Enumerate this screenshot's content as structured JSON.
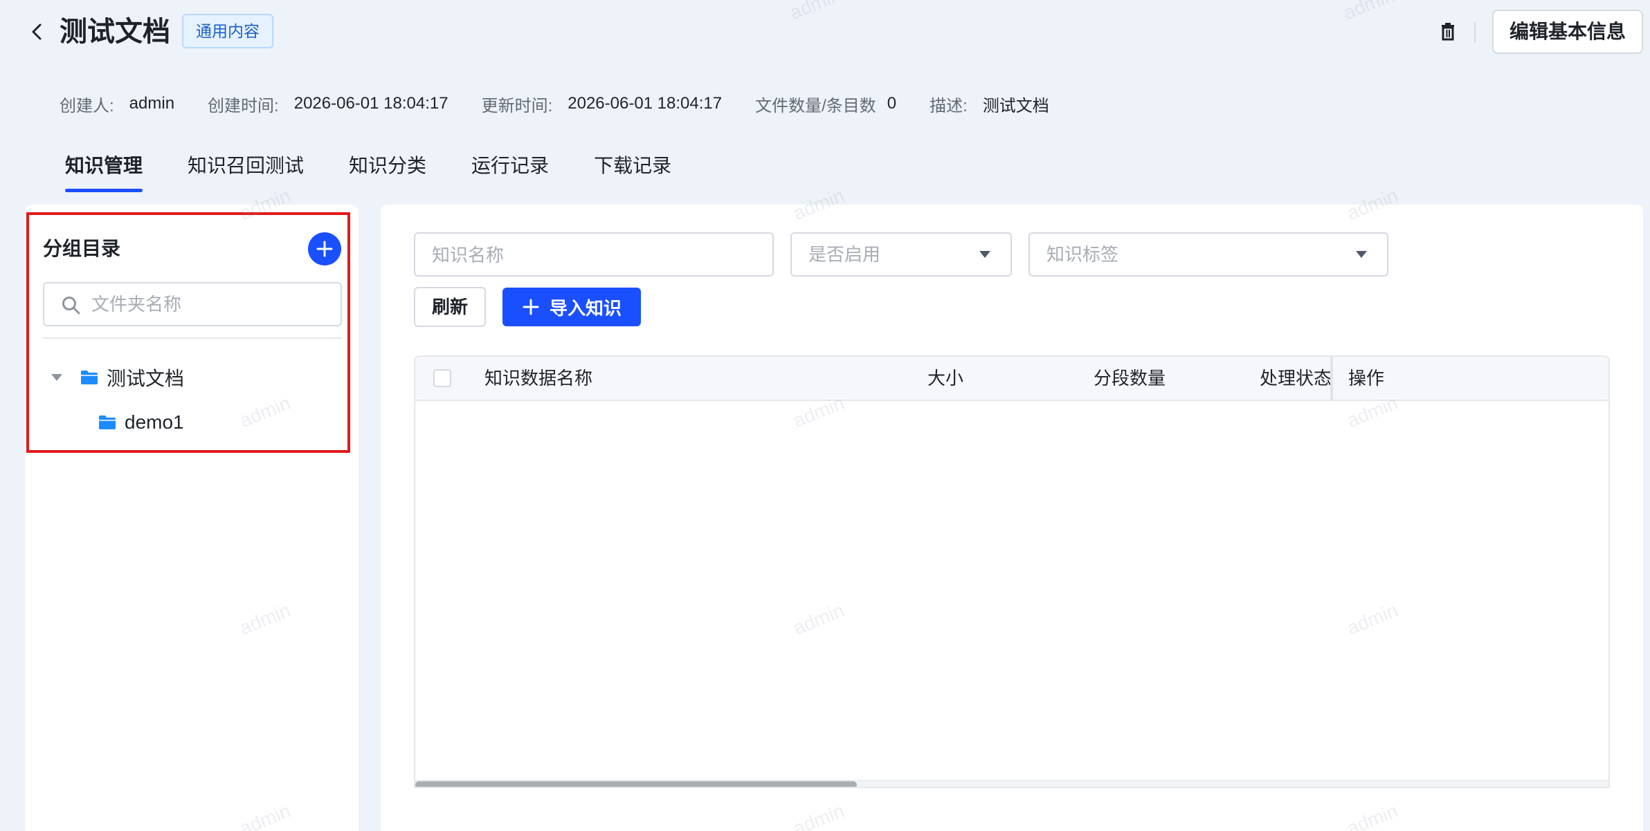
{
  "header": {
    "title": "测试文档",
    "tag": "通用内容",
    "edit_button": "编辑基本信息",
    "back_icon": "chevron-left-icon",
    "delete_icon": "trash-icon"
  },
  "meta": {
    "creator_label": "创建人:",
    "creator": "admin",
    "created_label": "创建时间:",
    "created": "2026-06-01 18:04:17",
    "updated_label": "更新时间:",
    "updated": "2026-06-01 18:04:17",
    "files_label": "文件数量/条目数",
    "files": "0",
    "desc_label": "描述:",
    "desc": "测试文档"
  },
  "tabs": [
    {
      "label": "知识管理",
      "active": true
    },
    {
      "label": "知识召回测试",
      "active": false
    },
    {
      "label": "知识分类",
      "active": false
    },
    {
      "label": "运行记录",
      "active": false
    },
    {
      "label": "下载记录",
      "active": false
    }
  ],
  "sidebar": {
    "title": "分组目录",
    "search_placeholder": "文件夹名称",
    "tree": {
      "root": "测试文档",
      "children": [
        "demo1"
      ]
    }
  },
  "filters": {
    "name_placeholder": "知识名称",
    "enabled_placeholder": "是否启用",
    "tag_placeholder": "知识标签"
  },
  "actions": {
    "refresh": "刷新",
    "import": "导入知识"
  },
  "table": {
    "columns": [
      "知识数据名称",
      "大小",
      "分段数量",
      "处理状态",
      "操作"
    ],
    "rows": []
  },
  "watermark": "admin",
  "colors": {
    "primary": "#1a4fff",
    "highlight_border": "#e01a1a",
    "tag_bg": "#e6f2ff",
    "tag_text": "#1c5fc9",
    "folder": "#1d8bff"
  }
}
